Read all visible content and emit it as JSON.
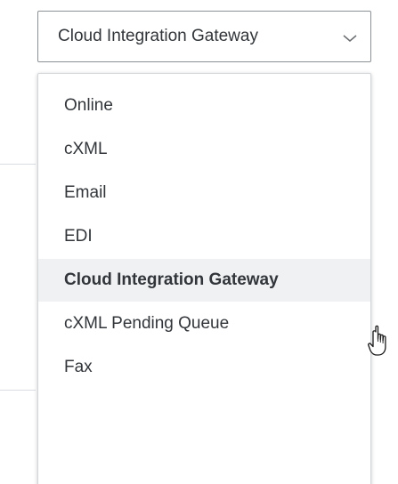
{
  "select": {
    "value": "Cloud Integration Gateway"
  },
  "menu": {
    "items": [
      {
        "label": "Online"
      },
      {
        "label": "cXML"
      },
      {
        "label": "Email"
      },
      {
        "label": "EDI"
      },
      {
        "label": "Cloud Integration Gateway",
        "selected": true
      },
      {
        "label": "cXML Pending Queue"
      },
      {
        "label": "Fax"
      }
    ]
  },
  "colors": {
    "text": "#32363a",
    "selected_background": "#f0f1f3",
    "border": "#8c9196"
  },
  "icons": {
    "chevron": "chevron-down-icon",
    "cursor": "hand-pointer-cursor-icon"
  }
}
